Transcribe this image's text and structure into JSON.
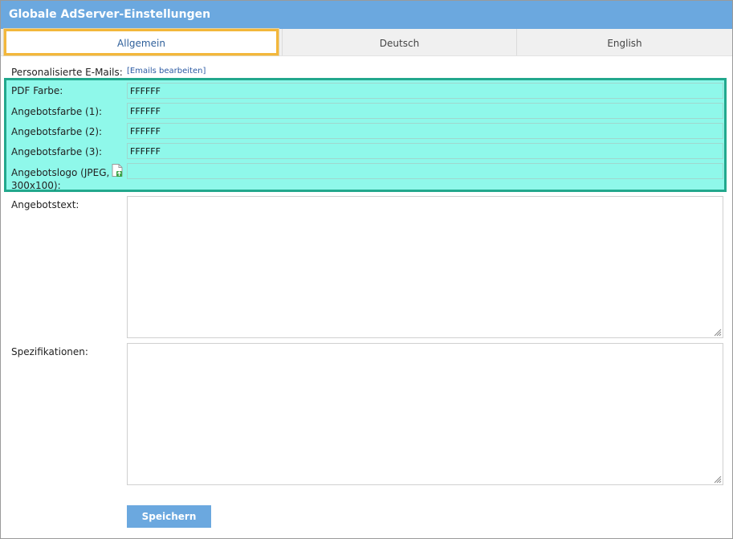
{
  "window": {
    "title": "Globale AdServer-Einstellungen"
  },
  "tabs": [
    {
      "label": "Allgemein"
    },
    {
      "label": "Deutsch"
    },
    {
      "label": "English"
    }
  ],
  "form": {
    "personalized_emails_label": "Personalisierte E-Mails:",
    "edit_emails_link": "[Emails bearbeiten]",
    "pdf_color_label": "PDF Farbe:",
    "pdf_color_value": "FFFFFF",
    "offer_color1_label": "Angebotsfarbe (1):",
    "offer_color1_value": "FFFFFF",
    "offer_color2_label": "Angebotsfarbe (2):",
    "offer_color2_value": "FFFFFF",
    "offer_color3_label": "Angebotsfarbe (3):",
    "offer_color3_value": "FFFFFF",
    "offer_logo_label_line1": "Angebotslogo (JPEG,",
    "offer_logo_label_line2": "300x100):",
    "offer_logo_value": "",
    "offer_text_label": "Angebotstext:",
    "specifications_label": "Spezifikationen:",
    "save_button": "Speichern"
  },
  "colors": {
    "title_bar": "#6ba8df",
    "highlight_fill": "#8ff8ea",
    "highlight_border": "#22a88d",
    "active_tab_border": "#f3b73b"
  }
}
